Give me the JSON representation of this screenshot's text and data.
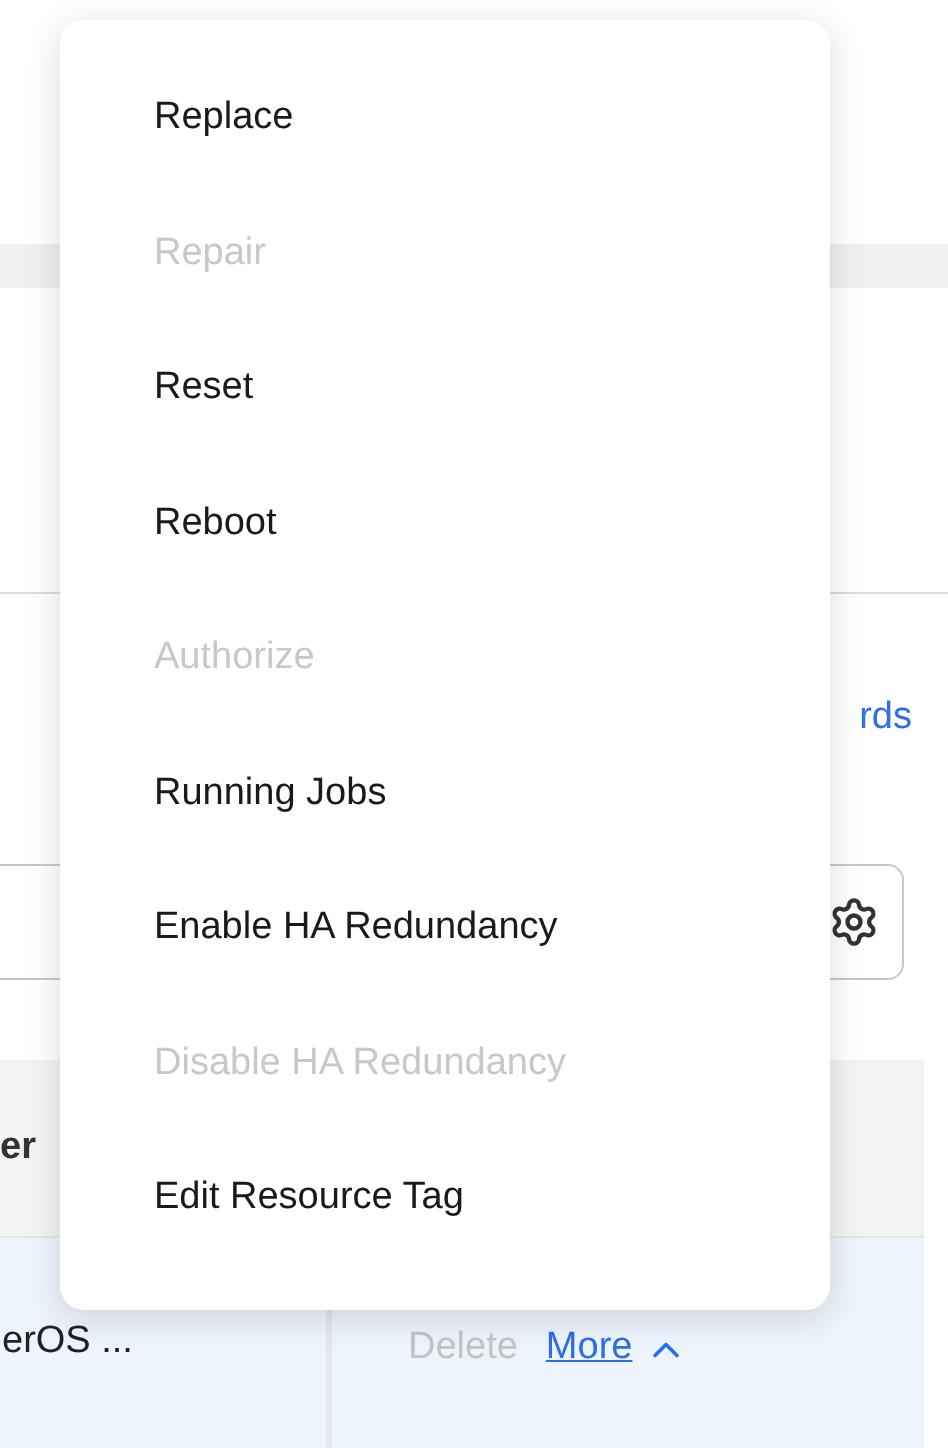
{
  "toolbar": {
    "link": "rds"
  },
  "table": {
    "header": {
      "column_1": "er"
    },
    "row": {
      "name": "erOS ...",
      "actions": {
        "delete": {
          "label": "Delete",
          "disabled": true
        },
        "more": {
          "label": "More",
          "expanded": true
        }
      }
    }
  },
  "menu": {
    "items": [
      {
        "label": "Replace",
        "disabled": false
      },
      {
        "label": "Repair",
        "disabled": true
      },
      {
        "label": "Reset",
        "disabled": false
      },
      {
        "label": "Reboot",
        "disabled": false
      },
      {
        "label": "Authorize",
        "disabled": true
      },
      {
        "label": "Running Jobs",
        "disabled": false
      },
      {
        "label": "Enable HA Redundancy",
        "disabled": false
      },
      {
        "label": "Disable HA Redundancy",
        "disabled": true
      },
      {
        "label": "Edit Resource Tag",
        "disabled": false
      }
    ]
  }
}
